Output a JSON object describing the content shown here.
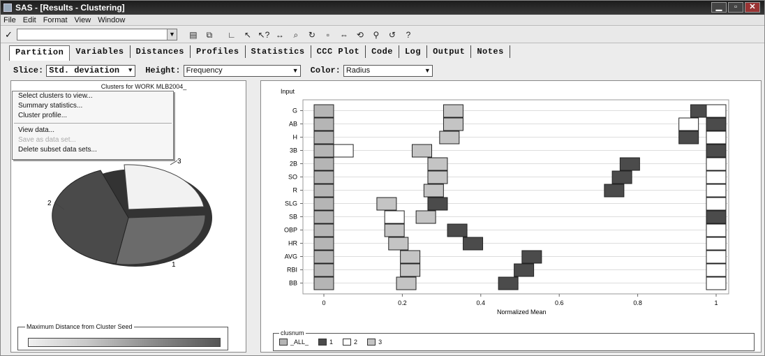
{
  "window": {
    "title": "SAS - [Results - Clustering]",
    "controls": [
      "minimize",
      "maximize",
      "close"
    ]
  },
  "menu": [
    "File",
    "Edit",
    "Format",
    "View",
    "Window"
  ],
  "toolbar": {
    "check": "✓",
    "icons": [
      "print-icon",
      "copy-icon",
      "axis-icon",
      "pointer-icon",
      "help-pointer-icon",
      "move-icon",
      "zoom-icon",
      "rotate-icon",
      "select-icon",
      "pan-icon",
      "reset-icon",
      "search-icon",
      "reload-icon",
      "help-icon"
    ]
  },
  "tabs": [
    "Partition",
    "Variables",
    "Distances",
    "Profiles",
    "Statistics",
    "CCC Plot",
    "Code",
    "Log",
    "Output",
    "Notes"
  ],
  "controls": {
    "slice_label": "Slice:",
    "slice_value": "Std. deviation",
    "height_label": "Height:",
    "height_value": "Frequency",
    "color_label": "Color:",
    "color_value": "Radius"
  },
  "left_panel": {
    "title": "Clusters for WORK MLB2004_",
    "context_menu": [
      {
        "label": "Select clusters to view...",
        "enabled": true
      },
      {
        "label": "Summary statistics...",
        "enabled": true
      },
      {
        "label": "Cluster profile...",
        "enabled": true
      },
      {
        "sep": true
      },
      {
        "label": "View data...",
        "enabled": true
      },
      {
        "label": "Save as data set...",
        "enabled": false
      },
      {
        "label": "Delete subset data sets...",
        "enabled": true
      }
    ],
    "legend_title": "Maximum Distance from Cluster Seed"
  },
  "pie": {
    "slices": [
      {
        "label": "3",
        "share": 0.3,
        "color": "#f2f2f2"
      },
      {
        "label": "1",
        "share": 0.36,
        "color": "#6b6b6b"
      },
      {
        "label": "2",
        "share": 0.34,
        "color": "#4a4a4a"
      }
    ]
  },
  "chart_data": {
    "type": "scatter",
    "ylabel": "Input",
    "xlabel": "Normalized Mean",
    "xlim": [
      0,
      1
    ],
    "xticks": [
      "0",
      "0.2",
      "0.4",
      "0.6",
      "0.8",
      "1"
    ],
    "categories": [
      "G",
      "AB",
      "H",
      "3B",
      "2B",
      "SO",
      "R",
      "SLG",
      "SB",
      "OBP",
      "HR",
      "AVG",
      "RBI",
      "BB"
    ],
    "legend_title": "clusnum",
    "series": [
      {
        "name": "_ALL_",
        "color": "#b5b5b5",
        "values": [
          0,
          0,
          0,
          0,
          0,
          0,
          0,
          0,
          0,
          0,
          0,
          0,
          0,
          0
        ]
      },
      {
        "name": "1",
        "color": "#4b4b4b",
        "values": [
          0.96,
          1.0,
          0.93,
          1.0,
          0.78,
          0.76,
          0.74,
          0.29,
          1.0,
          0.34,
          0.38,
          0.53,
          0.51,
          0.47
        ]
      },
      {
        "name": "2",
        "color": "#ffffff",
        "values": [
          1.0,
          0.93,
          1.0,
          0.05,
          1.0,
          1.0,
          1.0,
          1.0,
          0.18,
          1.0,
          1.0,
          1.0,
          1.0,
          1.0
        ]
      },
      {
        "name": "3",
        "color": "#c4c4c4",
        "values": [
          0.33,
          0.33,
          0.32,
          0.25,
          0.29,
          0.29,
          0.28,
          0.16,
          0.26,
          0.18,
          0.19,
          0.22,
          0.22,
          0.21
        ]
      }
    ]
  }
}
